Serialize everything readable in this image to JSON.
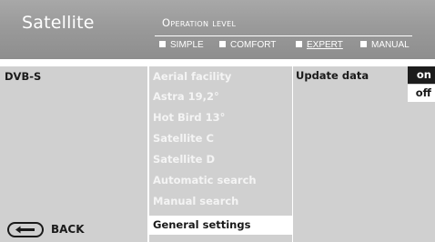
{
  "header": {
    "title": "Satellite",
    "operation_level_label": "Operation level",
    "levels": [
      {
        "label": "SIMPLE",
        "active": false
      },
      {
        "label": "COMFORT",
        "active": false
      },
      {
        "label": "EXPERT",
        "active": true
      },
      {
        "label": "MANUAL",
        "active": false
      }
    ]
  },
  "left_panel": {
    "item": "DVB-S",
    "back_label": "BACK",
    "back_icon": "back-arrow-icon"
  },
  "middle_panel": {
    "items": [
      "Aerial facility",
      "Astra 19,2°",
      "Hot Bird 13°",
      "Satellite C",
      "Satellite D",
      "Automatic search",
      "Manual search",
      "General settings"
    ],
    "selected_index": 7
  },
  "right_panel": {
    "label": "Update data",
    "options": [
      "on",
      "off"
    ],
    "selected": "on"
  },
  "colors": {
    "header_bg": "#9a9a9a",
    "panel_bg": "#d0d0d0",
    "selected_bg": "#ffffff",
    "on_bg": "#1c1c1c"
  }
}
